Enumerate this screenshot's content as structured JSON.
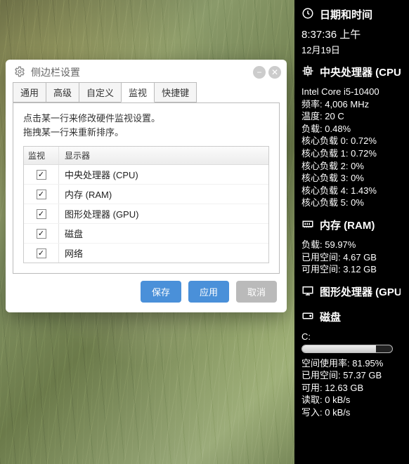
{
  "sidebar": {
    "datetime": {
      "title": "日期和时间",
      "time": "8:37:36 上午",
      "date": "12月19日"
    },
    "cpu": {
      "title": "中央处理器 (CPU)",
      "model": "Intel Core i5-10400",
      "freq_label": "频率:",
      "freq": "4,006 MHz",
      "temp_label": "温度:",
      "temp": "20 C",
      "load_label": "负载:",
      "load": "0.48%",
      "core_label": "核心负载",
      "cores": [
        "0.72%",
        "0.72%",
        "0%",
        "0%",
        "1.43%",
        "0%"
      ]
    },
    "ram": {
      "title": "内存 (RAM)",
      "load_label": "负载:",
      "load": "59.97%",
      "used_label": "已用空间:",
      "used": "4.67 GB",
      "free_label": "可用空间:",
      "free": "3.12 GB"
    },
    "gpu": {
      "title": "图形处理器 (GPU)"
    },
    "disk": {
      "title": "磁盘",
      "drive": "C:",
      "usage_label": "空间使用率:",
      "usage": "81.95%",
      "used_label": "已用空间:",
      "used": "57.37 GB",
      "free_label": "可用:",
      "free": "12.63 GB",
      "read_label": "读取:",
      "read": "0 kB/s",
      "write_label": "写入:",
      "write": "0 kB/s"
    }
  },
  "dialog": {
    "title": "侧边栏设置",
    "tabs": {
      "general": "通用",
      "advanced": "高级",
      "custom": "自定义",
      "monitor": "监视",
      "hotkey": "快捷键"
    },
    "pane": {
      "line1": "点击某一行来修改硬件监视设置。",
      "line2": "拖拽某一行来重新排序。"
    },
    "grid": {
      "col1": "监视",
      "col2": "显示器",
      "rows": [
        {
          "checked": true,
          "label": "中央处理器 (CPU)"
        },
        {
          "checked": true,
          "label": "内存 (RAM)"
        },
        {
          "checked": true,
          "label": "图形处理器 (GPU)"
        },
        {
          "checked": true,
          "label": "磁盘"
        },
        {
          "checked": true,
          "label": "网络"
        }
      ]
    },
    "buttons": {
      "save": "保存",
      "apply": "应用",
      "cancel": "取消"
    }
  }
}
